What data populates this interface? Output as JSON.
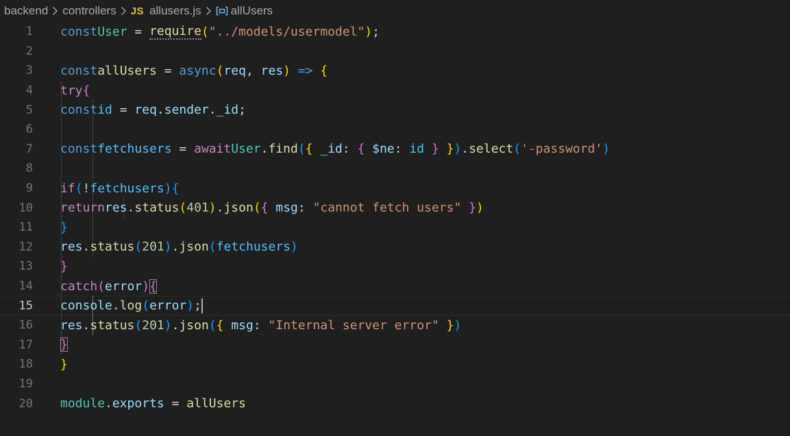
{
  "breadcrumb": {
    "folders": [
      "backend",
      "controllers"
    ],
    "file_badge": "JS",
    "file": "allusers.js",
    "symbol": "allUsers",
    "symbol_icon": "symbol-variable-icon"
  },
  "colors": {
    "background": "#1f1f1f",
    "keyword": "#569cd6",
    "control_keyword": "#c586c0",
    "class": "#4ec9b0",
    "function": "#dcdcaa",
    "variable": "#9cdcfe",
    "string": "#ce9178",
    "number": "#b5cea8",
    "bracket_level_1": "#ffd700",
    "bracket_level_2": "#da70d6",
    "bracket_level_3": "#179fff"
  },
  "editor": {
    "current_line": 15,
    "lines": [
      {
        "n": "1"
      },
      {
        "n": "2"
      },
      {
        "n": "3"
      },
      {
        "n": "4"
      },
      {
        "n": "5"
      },
      {
        "n": "6"
      },
      {
        "n": "7"
      },
      {
        "n": "8"
      },
      {
        "n": "9"
      },
      {
        "n": "10"
      },
      {
        "n": "11"
      },
      {
        "n": "12"
      },
      {
        "n": "13"
      },
      {
        "n": "14"
      },
      {
        "n": "15"
      },
      {
        "n": "16"
      },
      {
        "n": "17"
      },
      {
        "n": "18"
      },
      {
        "n": "19"
      },
      {
        "n": "20"
      }
    ],
    "tok": {
      "const": "const",
      "User": "User",
      "eq": " = ",
      "require": "require",
      "lp": "(",
      "rp": ")",
      "semi": ";",
      "models_path": "\"../models/usermodel\"",
      "allUsers": "allUsers",
      "async": "async",
      "req": "req",
      "res": "res",
      "comma": ", ",
      "arrow": " => ",
      "lb": "{",
      "rb": "}",
      "try": "try",
      "id": "id",
      "dot": ".",
      "sender": "sender",
      "_id": "_id",
      "fetchusers": "fetchusers",
      "await": "await",
      "find": "find",
      "lb_sp": "{ ",
      "rb_sp": " }",
      "colon": ": ",
      "ne": "$ne",
      "select": "select",
      "password_str": "'-password'",
      "if": "if",
      "not": "!",
      "return": "return",
      "status": "status",
      "json": "json",
      "n401": "401",
      "n201": "201",
      "msg": "msg",
      "cannot_fetch": "\"cannot fetch users\"",
      "catch": "catch",
      "error": "error",
      "console": "console",
      "log": "log",
      "internal_error": "\"Internal server error\"",
      "module": "module",
      "exports": "exports"
    }
  }
}
